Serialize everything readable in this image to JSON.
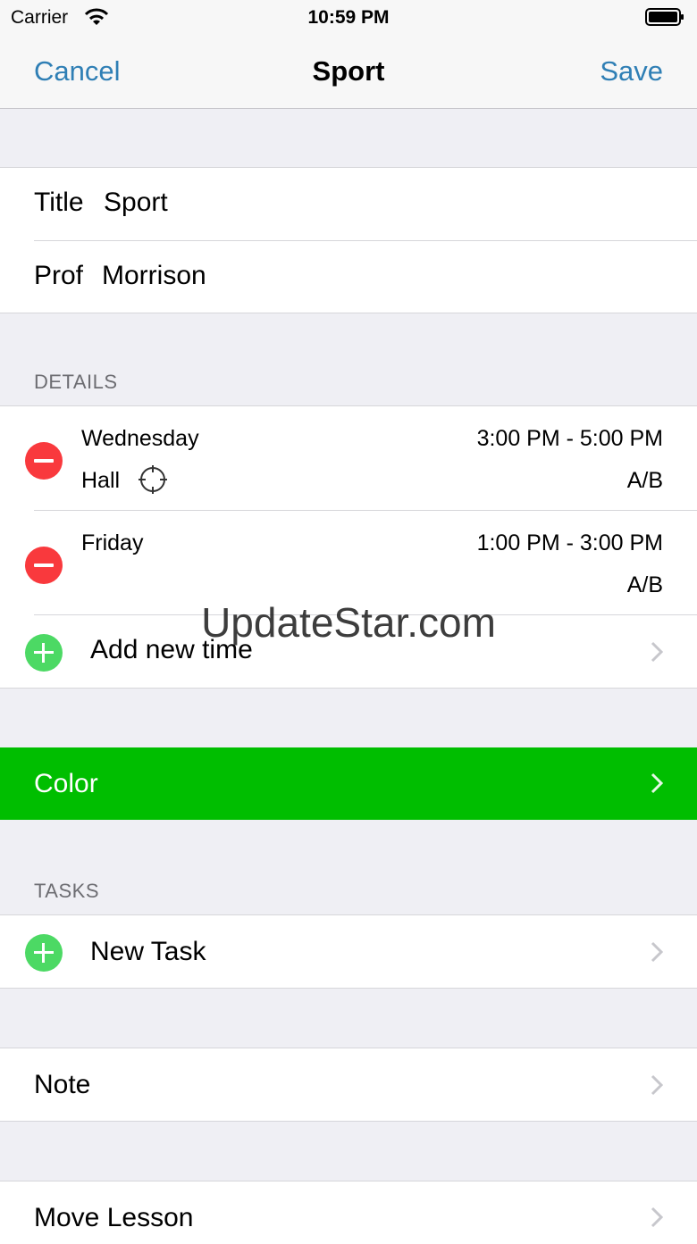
{
  "status_bar": {
    "carrier": "Carrier",
    "time": "10:59 PM"
  },
  "nav": {
    "cancel": "Cancel",
    "title": "Sport",
    "save": "Save"
  },
  "info": {
    "title_label": "Title",
    "title_value": "Sport",
    "prof_label": "Prof",
    "prof_value": "Morrison"
  },
  "details": {
    "header": "DETAILS",
    "times": [
      {
        "day": "Wednesday",
        "time": "3:00 PM - 5:00 PM",
        "location": "Hall",
        "week": "A/B"
      },
      {
        "day": "Friday",
        "time": "1:00 PM - 3:00 PM",
        "location": "",
        "week": "A/B"
      }
    ],
    "add_label": "Add new time"
  },
  "color": {
    "label": "Color",
    "value": "#00be00"
  },
  "tasks": {
    "header": "TASKS",
    "new_task": "New Task"
  },
  "note": {
    "label": "Note"
  },
  "move": {
    "label": "Move Lesson"
  },
  "watermark": "UpdateStar.com",
  "colors": {
    "accent": "#2f7fb5",
    "destructive": "#f9393d",
    "add": "#4cd964",
    "background": "#efeff4"
  }
}
